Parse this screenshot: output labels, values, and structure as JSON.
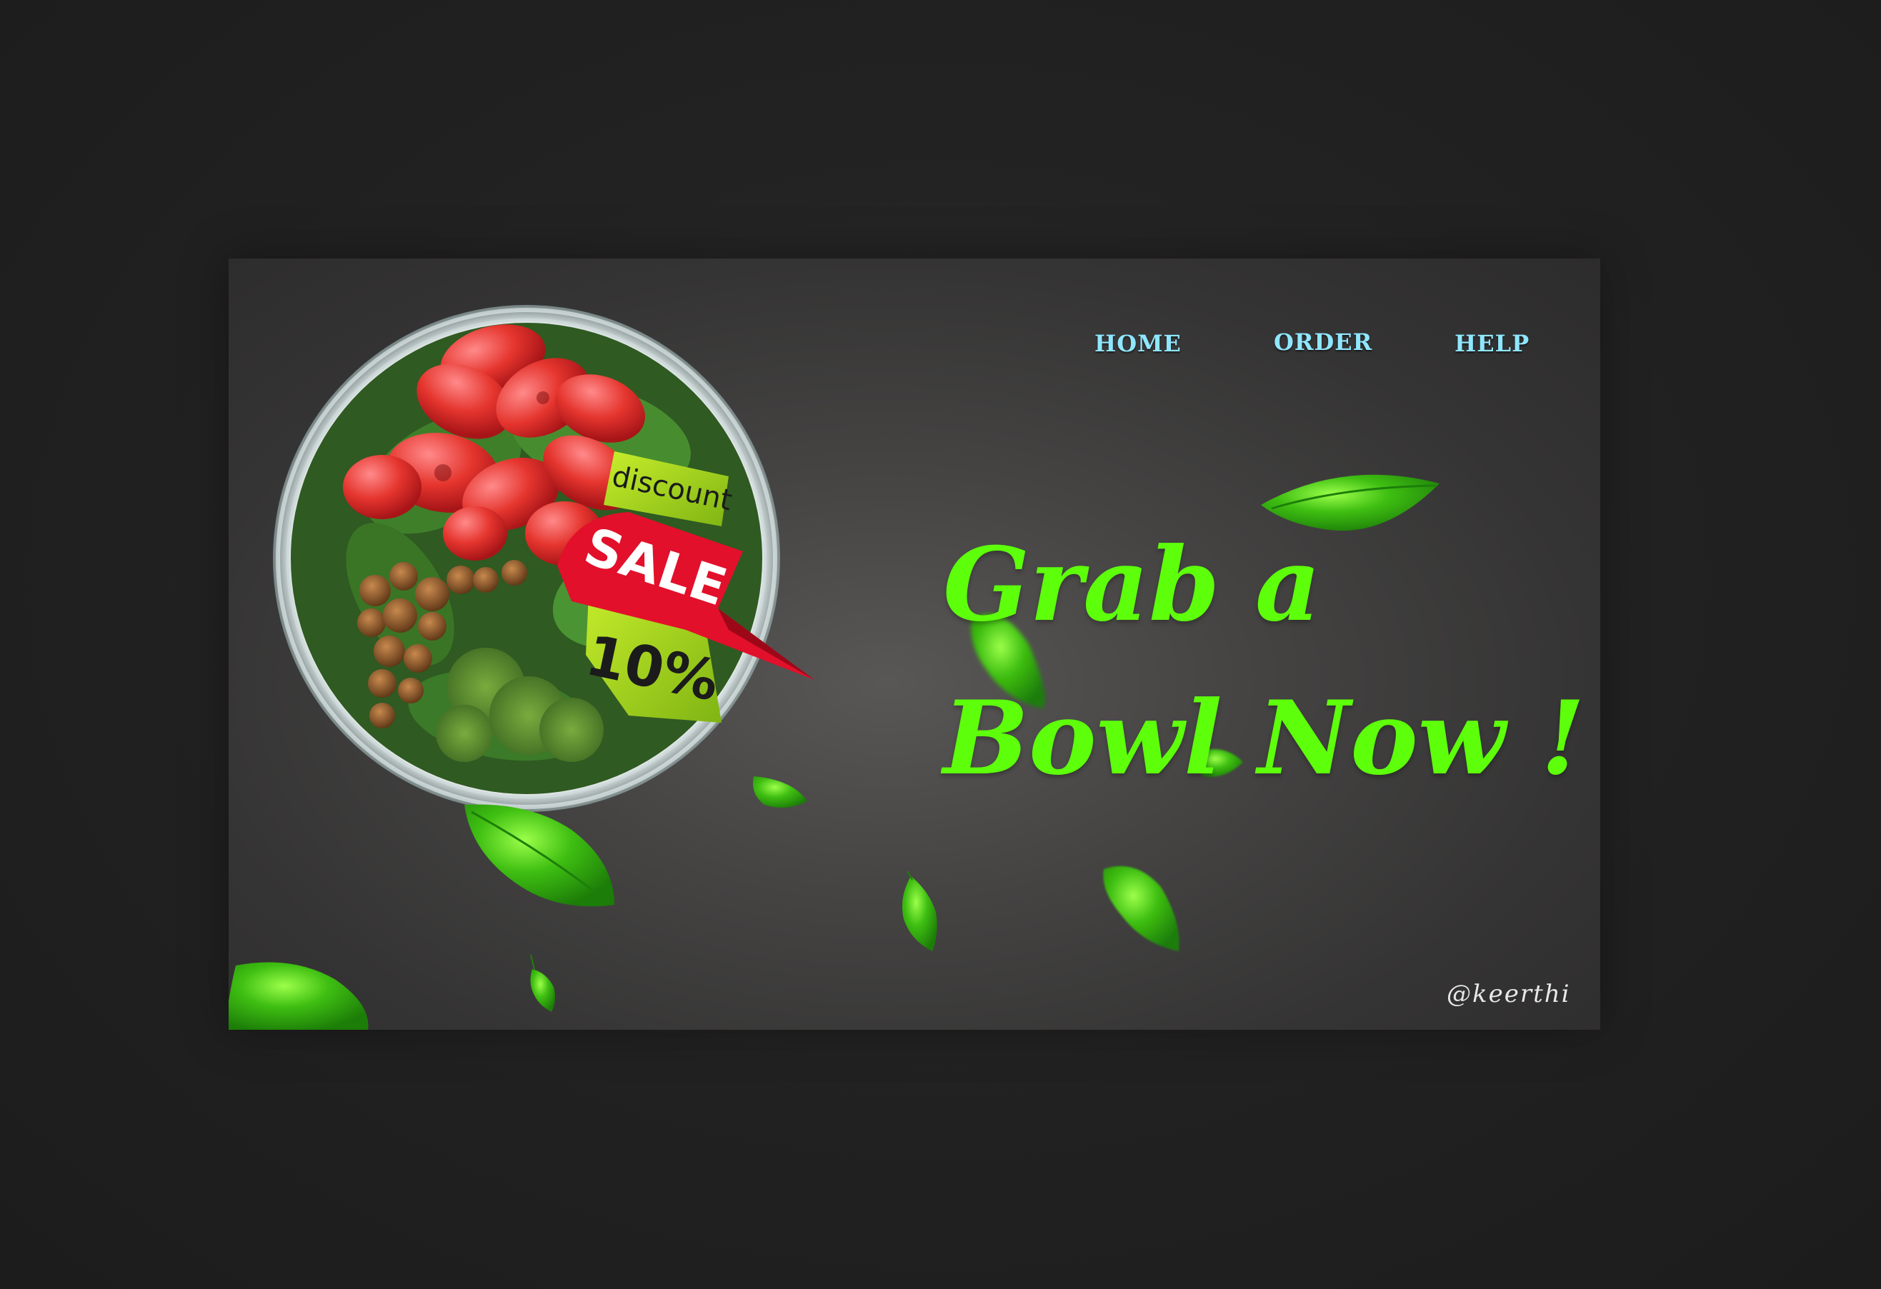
{
  "nav": {
    "home": "HOME",
    "order": "ORDER",
    "help": "HELP"
  },
  "hero": {
    "line1": "Grab a",
    "line2": "Bowl Now !"
  },
  "promo": {
    "top": "discount",
    "middle": "SALE",
    "bottom": "10%"
  },
  "signature": "@keerthi",
  "colors": {
    "headline": "#5dff0a",
    "nav": "#8fe7ff",
    "badge_green": "#a6d71a",
    "badge_red": "#e2102b",
    "background": "#454443"
  },
  "icons": [
    "salad-bowl-image",
    "discount-sale-badge",
    "leaf-icon"
  ]
}
